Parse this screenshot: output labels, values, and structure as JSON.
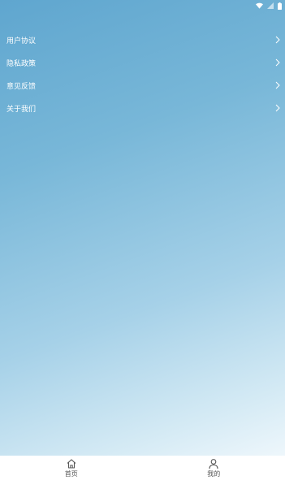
{
  "menu": {
    "items": [
      {
        "label": "用户协议",
        "icon": "chevron-right-icon"
      },
      {
        "label": "隐私政策",
        "icon": "chevron-right-icon"
      },
      {
        "label": "意见反馈",
        "icon": "chevron-right-icon"
      },
      {
        "label": "关于我们",
        "icon": "chevron-right-icon"
      }
    ]
  },
  "tabbar": {
    "tabs": [
      {
        "label": "首页",
        "icon": "home-icon"
      },
      {
        "label": "我的",
        "icon": "user-icon"
      }
    ]
  },
  "colors": {
    "gradient_top": "#5fa6cf",
    "gradient_bottom": "#f7fbfe",
    "menu_text": "#ffffff",
    "tab_label": "#555555",
    "tabbar_bg": "#ffffff"
  }
}
